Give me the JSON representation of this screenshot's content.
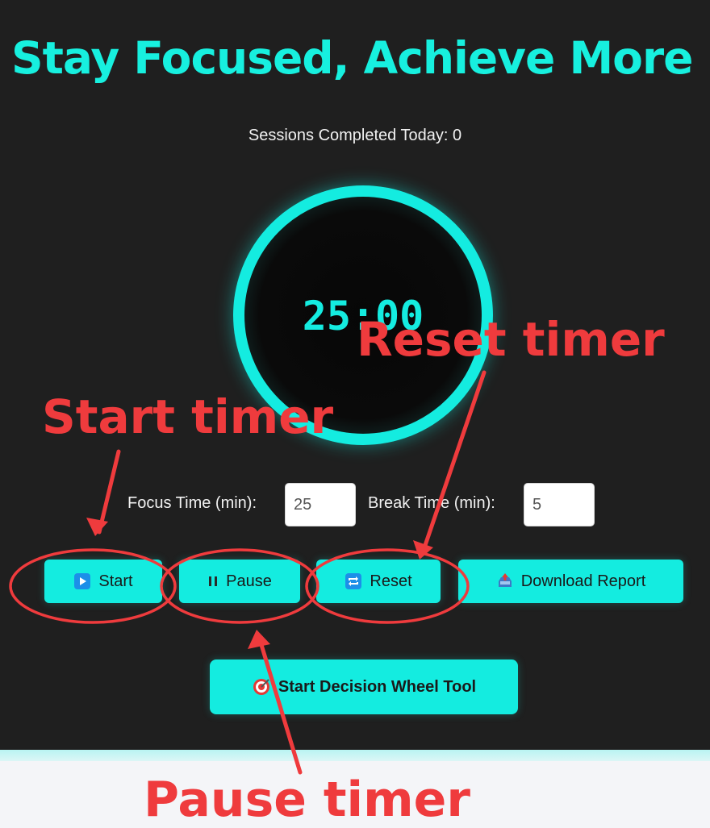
{
  "header": {
    "title": "Stay Focused, Achieve More"
  },
  "stats": {
    "sessions_text": "Sessions Completed Today: 0"
  },
  "timer": {
    "display": "25:00"
  },
  "settings": {
    "focus_label": "Focus Time (min):",
    "focus_value": "25",
    "break_label": "Break Time (min):",
    "break_value": "5"
  },
  "controls": {
    "start_label": "Start",
    "pause_label": "Pause",
    "reset_label": "Reset",
    "download_label": "Download Report",
    "wheel_label": "Start Decision Wheel Tool"
  },
  "annotations": {
    "start": "Start timer",
    "pause": "Pause timer",
    "reset": "Reset timer"
  },
  "colors": {
    "accent": "#14ece0",
    "background": "#1f1f1f",
    "annotation": "#ef3b3d"
  },
  "icons": {
    "start": "play-icon",
    "pause": "pause-icon",
    "reset": "repeat-icon",
    "download": "inbox-tray-icon",
    "wheel": "target-icon"
  }
}
